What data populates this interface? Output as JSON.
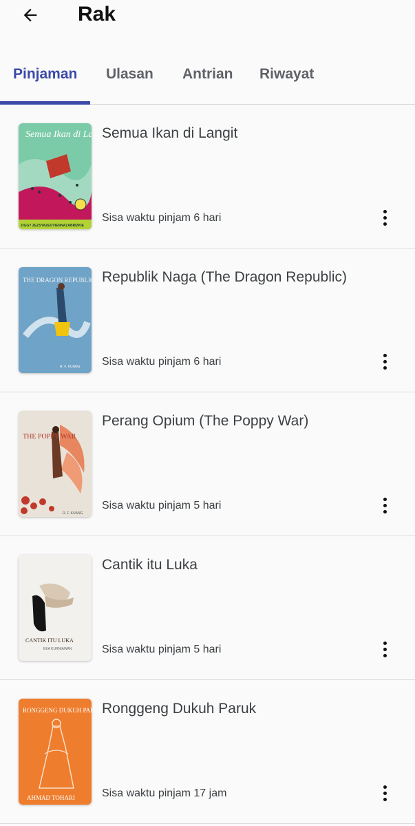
{
  "header": {
    "title": "Rak",
    "back_icon": "arrow-back-icon"
  },
  "tabs": [
    {
      "label": "Pinjaman",
      "active": true
    },
    {
      "label": "Ulasan",
      "active": false
    },
    {
      "label": "Antrian",
      "active": false
    },
    {
      "label": "Riwayat",
      "active": false
    }
  ],
  "accent_color": "#3b4aa8",
  "books": [
    {
      "title": "Semua Ikan di Langit",
      "loan_time": "Sisa waktu pinjam 6 hari",
      "cover_text": {
        "title": "Semua Ikan di Langit",
        "author": "ZIGGY ZEZSYAZEOVIENNAZABRIZKIE"
      }
    },
    {
      "title": "Republik Naga (The Dragon Republic)",
      "loan_time": "Sisa waktu pinjam 6 hari",
      "cover_text": {
        "title": "THE DRAGON REPUBLIC",
        "author": "R. F. KUANG"
      }
    },
    {
      "title": "Perang Opium (The Poppy War)",
      "loan_time": "Sisa waktu pinjam 5 hari",
      "cover_text": {
        "title": "THE POPPY WAR",
        "author": "R. F. KUANG"
      }
    },
    {
      "title": "Cantik itu Luka",
      "loan_time": "Sisa waktu pinjam 5 hari",
      "cover_text": {
        "title": "CANTIK ITU LUKA",
        "author": "EKA KURNIAWAN"
      }
    },
    {
      "title": "Ronggeng Dukuh Paruk",
      "loan_time": "Sisa waktu pinjam 17 jam",
      "cover_text": {
        "title": "RONGGENG DUKUH PARUK",
        "author": "AHMAD TOHARI"
      }
    }
  ]
}
